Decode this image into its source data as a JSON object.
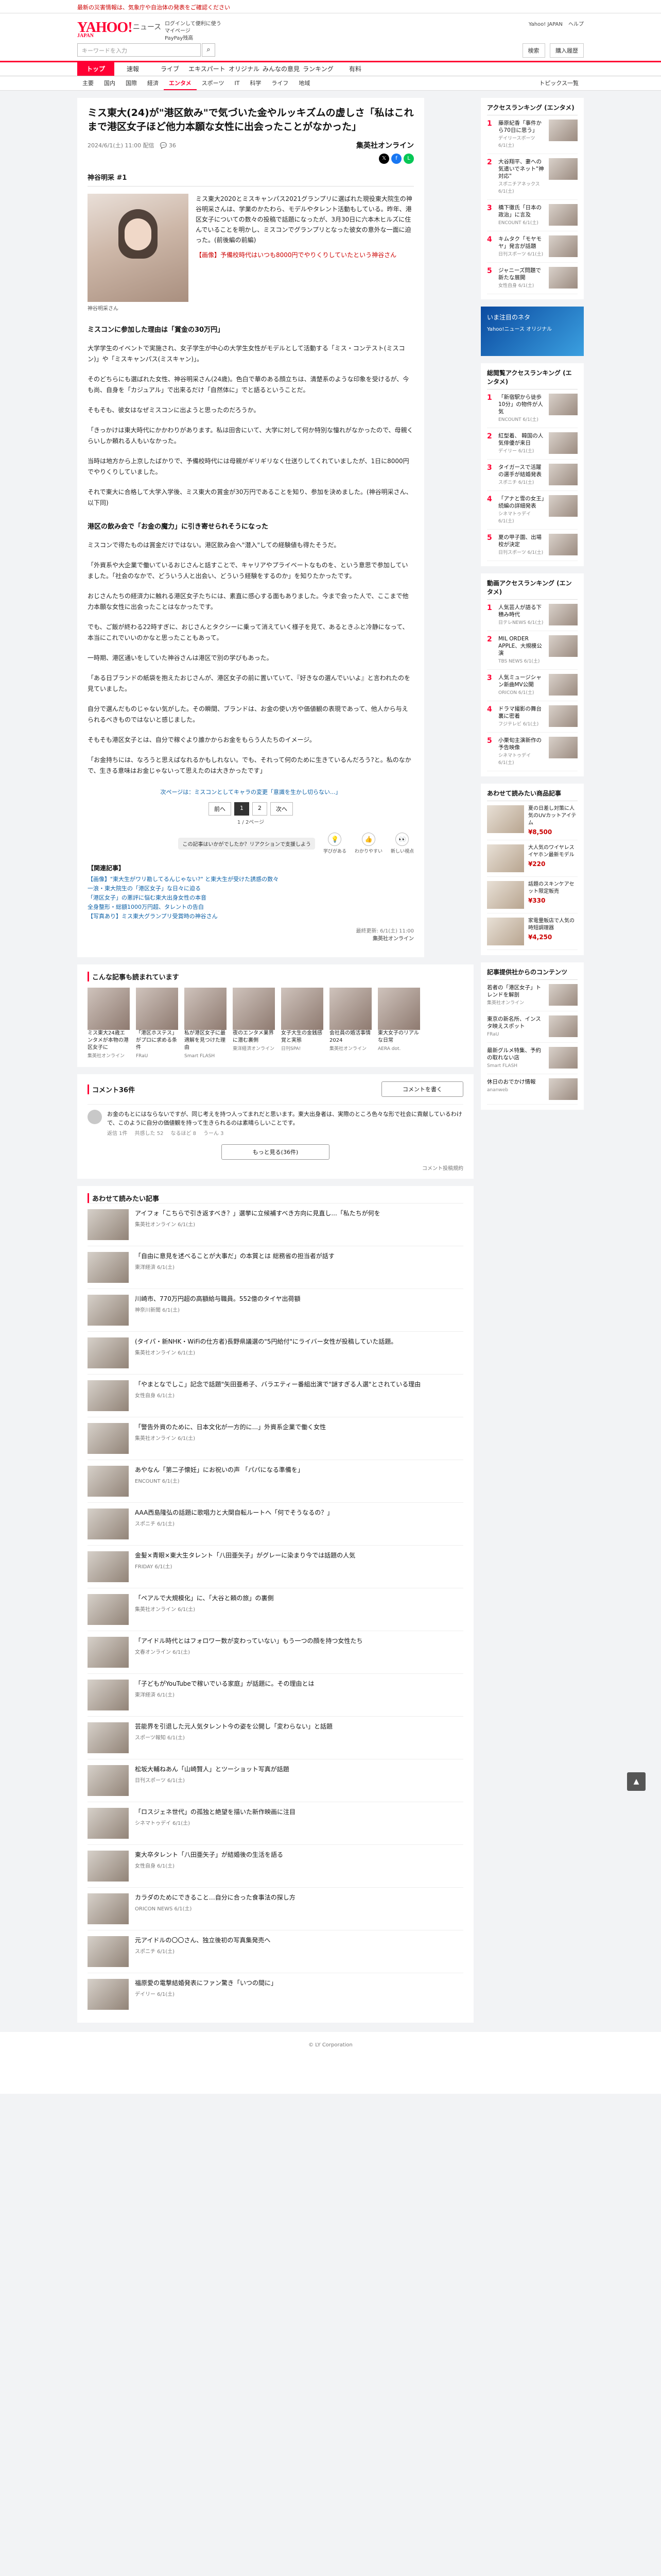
{
  "notice": "最新の災害情報は、気象庁や自治体の発表をご確認ください",
  "header": {
    "logo": "YAHOO!",
    "logo_sub": "JAPAN",
    "section": "ニュース",
    "links": [
      "ログインして便利に使う",
      "マイページ",
      "PayPay残高"
    ],
    "top_links": [
      "Yahoo! JAPAN",
      "ヘルプ"
    ],
    "search_placeholder": "キーワードを入力",
    "right_buttons": [
      "検索",
      "購入履歴"
    ]
  },
  "gnav": [
    "トップ",
    "速報",
    "ライブ",
    "エキスパート",
    "オリジナル",
    "みんなの意見",
    "ランキング",
    "有料"
  ],
  "subnav": [
    "主要",
    "国内",
    "国際",
    "経済",
    "エンタメ",
    "スポーツ",
    "IT",
    "科学",
    "ライフ",
    "地域"
  ],
  "topics_label": "トピックス一覧",
  "article": {
    "title": "ミス東大(24)が\"港区飲み\"で気づいた金やルッキズムの虚しさ「私はこれまで港区女子ほど他力本願な女性に出会ったことがなかった」",
    "date": "2024/6/1(土) 11:00 配信",
    "comments": "36",
    "publisher": "集英社オンライン",
    "keyword": "神谷明采 #1",
    "caption": "神谷明采さん",
    "lead": "ミス東大2020とミスキャンパス2021グランプリに選ばれた現役東大院生の神谷明采さんは、学業のかたわら、モデルやタレント活動もしている。昨年、港区女子についての数々の投稿で話題になったが、3月30日に六本木ヒルズに住んでいることを明かし、ミスコンでグランプリとなった彼女の意外な一面に迫った。(前後編の前編)",
    "promo": "【画像】予備校時代はいつも8000円でやりくりしていたという神谷さん",
    "h1": "ミスコンに参加した理由は「賞金の30万円」",
    "paragraphs": [
      "大学学生のイベントで実施され、女子学生が中心の大学生女性がモデルとして活動する「ミス・コンテスト(ミスコン)」や「ミスキャンパス(ミスキャン)」。",
      "そのどちらにも選ばれた女性、神谷明采さん(24歳)。色白で華のある顔立ちは、清楚系のような印象を受けるが、今も尚、自身を「カジュアル」で出来るだけ「自然体に」でと語るということだ。",
      "そもそも、彼女はなぜミスコンに出ようと思ったのだろうか。",
      "「きっかけは東大時代にかかわりがあります。私は田舎にいて、大学に対して何か特別な憧れがなかったので、母親くらいしか頼れる人もいなかった。",
      "当時は地方から上京したばかりで、予備校時代には母親がギリギリなく仕送りしてくれていましたが、1日に8000円でやりくりしていました。",
      "それで東大に合格して大学入学後、ミス東大の賞金が30万円であることを知り、参加を決めました。(神谷明采さん、以下同)"
    ],
    "h2": "港区の飲み会で「お金の魔力」に引き寄せられそうになった",
    "paragraphs2": [
      "ミスコンで得たものは賞金だけではない。港区飲み会へ\"潜入\"しての経験値も得たそうだ。",
      "「外資系や大企業で働いているおじさんと話すことで、キャリアやプライベートなものを、という意思で参加していました。「社会のなかで、どういう人と出会い、どういう経験をするのか」を知りたかったです。",
      "おじさんたちの経済力に触れる港区女子たちには、素直に感心する面もありました。今まで会った人で、ここまで他力本願な女性に出会ったことはなかったです。",
      "でも、ご飯が終わる22時すぎに、おじさんとタクシーに乗って消えていく様子を見て、あるときふと冷静になって、本当にこれでいいのかなと思ったこともあって。",
      "一時期、港区通いをしていた神谷さんは港区で別の学びもあった。",
      "「ある日ブランドの紙袋を抱えたおじさんが、港区女子の前に置いていて、『好きなの選んでいいよ』と言われたのを見ていました。",
      "自分で選んだものじゃない気がした。その瞬間、ブランドは、お金の使い方や価値観の表現であって、他人から与えられるべきものではないと感じました。",
      "そもそも港区女子とは、自分で稼ぐより誰かからお金をもらう人たちのイメージ。",
      "「お金持ちには、なろうと思えばなれるかもしれない。でも、それって何のために生きているんだろう?と。私のなかで、生きる意味はお金じゃないって思えたのは大きかったです」"
    ],
    "read_next": "次ページは：ミスコンとしてキャラの変更「意識を生かし切らない...」",
    "pager": {
      "prev": "前へ",
      "current": "1",
      "page2": "2",
      "next": "次へ"
    },
    "page_count": "1 / 2ページ",
    "reaction_tip": "この記事はいかがでしたか？リアクションで支援しよう",
    "reactions": [
      {
        "label": "学びがある",
        "icon": "💡"
      },
      {
        "label": "わかりやすい",
        "icon": "👍"
      },
      {
        "label": "新しい視点",
        "icon": "👀"
      }
    ],
    "related_head": "【関連記事】",
    "related": [
      "【画像】\"東大生がワリ勘してるんじゃない?\" と東大生が受けた誘惑の数々",
      "一浪・東大院生の「港区女子」な日々に迫る",
      "「港区女子」の悪評に悩む東大出身女性の本音",
      "全身整形・総額1000万円超、タレントの告白",
      "【写真あり】ミス東大グランプリ受賞時の神谷さん"
    ],
    "copyright": "最終更新: 6/1(土) 11:00",
    "copyright2": "集英社オンライン"
  },
  "recommend": {
    "title": "こんな記事も読まれています",
    "cards": [
      {
        "text": "ミス東大24歳エンタメが本物の港区女子に",
        "src": "集英社オンライン"
      },
      {
        "text": "「港区ホステス」がプロに求める条件",
        "src": "FRaU"
      },
      {
        "text": "私が港区女子に最適解を見つけた理由",
        "src": "Smart FLASH"
      },
      {
        "text": "夜のエンタメ業界に潜む裏側",
        "src": "東洋経済オンライン"
      },
      {
        "text": "女子大生の金銭感覚と実態",
        "src": "日刊SPA!"
      },
      {
        "text": "会社員の婚活事情2024",
        "src": "集英社オンライン"
      },
      {
        "text": "東大女子のリアルな日常",
        "src": "AERA dot."
      }
    ]
  },
  "comments": {
    "title": "コメント36件",
    "button": "コメントを書く",
    "items": [
      {
        "text": "お金のもとにはならないですが、同じ考えを持つ人ってまれだと思います。東大出身者は、実際のところ色々な形で社会に貢献しているわけで、このように自分の価値観を持って生きられるのは素晴らしいことです。",
        "user": "返信 1件",
        "likes": "共感した 52",
        "hmm": "なるほど 8",
        "bad": "うーん 3"
      }
    ],
    "more": "もっと見る(36件)",
    "note": "コメント投稿規約"
  },
  "alsoread": {
    "title": "あわせて読みたい記事",
    "items": [
      {
        "t": "アイフォ「こちらで引き返すべき？」選挙に立候補すべき方向に見直し...「私たちが何を",
        "s": "集英社オンライン 6/1(土)"
      },
      {
        "t": "「自由に意見を述べることが大事だ」の本質とは 総務省の担当者が話す",
        "s": "東洋経済 6/1(土)"
      },
      {
        "t": "川崎市、770万円超の高額給与職員。552億のタイヤ出荷額",
        "s": "神奈川新聞 6/1(土)"
      },
      {
        "t": "(タイパ・新NHK・WiFiの仕方者)長野県議選の\"5円給付\"にライバー女性が投稿していた話題。",
        "s": "集英社オンライン 6/1(土)"
      },
      {
        "t": "「やまとなでしこ」記念で話題\"矢田亜希子、バラエティー番組出演で\"謎すぎる人選\"とされている理由",
        "s": "女性自身 6/1(土)"
      },
      {
        "t": "「警告外資のために、日本文化が一方的に...」外資系企業で働く女性",
        "s": "集英社オンライン 6/1(土)"
      },
      {
        "t": "あやなん「第二子懐妊」にお祝いの声 「パパになる準備を」",
        "s": "ENCOUNT 6/1(土)"
      },
      {
        "t": "AAA西島隆弘の話題に歌唱力と大関自転ルートへ「何でそうなるの？」",
        "s": "スポニチ 6/1(土)"
      },
      {
        "t": "金髪×青眼×東大生タレント「八田亜矢子」がグレーに染まり今では話題の人気",
        "s": "FRIDAY 6/1(土)"
      },
      {
        "t": "「ペアルで大規模化」に、「大谷と頼の旅」の裏側",
        "s": "集英社オンライン 6/1(土)"
      },
      {
        "t": "「アイドル時代とはフォロワー数が変わっていない」もう一つの顔を持つ女性たち",
        "s": "文春オンライン 6/1(土)"
      },
      {
        "t": "「子どもがYouTubeで稼いでいる家庭」が話題に。その理由とは",
        "s": "東洋経済 6/1(土)"
      },
      {
        "t": "芸能界を引退した元人気タレント今の姿を公開し「変わらない」と話題",
        "s": "スポーツ報知 6/1(土)"
      },
      {
        "t": "松坂大輔ねあん「山崎賢人」とツーショット写真が話題",
        "s": "日刊スポーツ 6/1(土)"
      },
      {
        "t": "「ロスジェネ世代」の孤独と絶望を描いた新作映画に注目",
        "s": "シネマトゥデイ 6/1(土)"
      },
      {
        "t": "東大卒タレント「八田亜矢子」が結婚後の生活を語る",
        "s": "女性自身 6/1(土)"
      },
      {
        "t": "カラダのためにできること…自分に合った食事法の探し方",
        "s": "ORICON NEWS 6/1(土)"
      },
      {
        "t": "元アイドルの〇〇さん、独立後初の写真集発売へ",
        "s": "スポニチ 6/1(土)"
      },
      {
        "t": "福原愛の電撃結婚発表にファン驚き「いつの間に」",
        "s": "デイリー 6/1(土)"
      }
    ]
  },
  "side": {
    "access_title": "アクセスランキング (エンタメ)",
    "access": [
      {
        "t": "藤原紀香「事件から70日に思う」",
        "s": "デイリースポーツ 6/1(土)"
      },
      {
        "t": "大谷翔平、妻への気遣いでネット\"神対応\"",
        "s": "スポニチアネックス 6/1(土)"
      },
      {
        "t": "橋下徹氏「日本の政治」に言及",
        "s": "ENCOUNT 6/1(土)"
      },
      {
        "t": "キムタク「モヤモヤ」発言が話題",
        "s": "日刊スポーツ 6/1(土)"
      },
      {
        "t": "ジャニーズ問題で新たな展開",
        "s": "女性自身 6/1(土)"
      }
    ],
    "banner": "いま注目のネタ",
    "banner2": "Yahoo!ニュース オリジナル",
    "comm_title": "総閲覧アクセスランキング (エンタメ)",
    "comm": [
      {
        "t": "「新宿駅から徒歩10分」の物件が人気",
        "s": "ENCOUNT 6/1(土)"
      },
      {
        "t": "紅型着、 韓国の人気俳優が来日",
        "s": "デイリー 6/1(土)"
      },
      {
        "t": "タイガースで活躍の選手が結婚発表",
        "s": "スポニチ 6/1(土)"
      },
      {
        "t": "「アナと雪の女王」続編の詳細発表",
        "s": "シネマトゥデイ 6/1(土)"
      },
      {
        "t": "夏の甲子園、出場校が決定",
        "s": "日刊スポーツ 6/1(土)"
      }
    ],
    "video_title": "動画アクセスランキング (エンタメ)",
    "video": [
      {
        "t": "人気芸人が語る下積み時代",
        "s": "日テレNEWS 6/1(土)"
      },
      {
        "t": "MIL ORDER APPLE、大規模公演",
        "s": "TBS NEWS 6/1(土)"
      },
      {
        "t": "人気ミュージシャン新曲MV公開",
        "s": "ORICON 6/1(土)"
      },
      {
        "t": "ドラマ撮影の舞台裏に密着",
        "s": "フジテレビ 6/1(土)"
      },
      {
        "t": "小栗旬主演新作の予告映像",
        "s": "シネマトゥデイ 6/1(土)"
      }
    ],
    "ad_title": "あわせて読みたい商品記事",
    "ads": [
      {
        "t": "夏の日差し対策に人気のUVカットアイテム",
        "p": "¥8,500"
      },
      {
        "t": "大人気のワイヤレスイヤホン最新モデル",
        "p": "¥220"
      },
      {
        "t": "話題のスキンケアセット限定販売",
        "p": "¥330"
      },
      {
        "t": "家電量販店で人気の時短調理器",
        "p": "¥4,250"
      }
    ],
    "recruit_title": "記事提供社からのコンテンツ",
    "recruit": [
      {
        "t": "若者の「港区女子」トレンドを解剖",
        "s": "集英社オンライン"
      },
      {
        "t": "東京の新名所、インスタ映えスポット",
        "s": "FRaU"
      },
      {
        "t": "最新グルメ特集、予約の取れない店",
        "s": "Smart FLASH"
      },
      {
        "t": "休日のおでかけ情報",
        "s": "ananweb"
      }
    ]
  },
  "pagetop": "▲",
  "footer": "© LY Corporation"
}
